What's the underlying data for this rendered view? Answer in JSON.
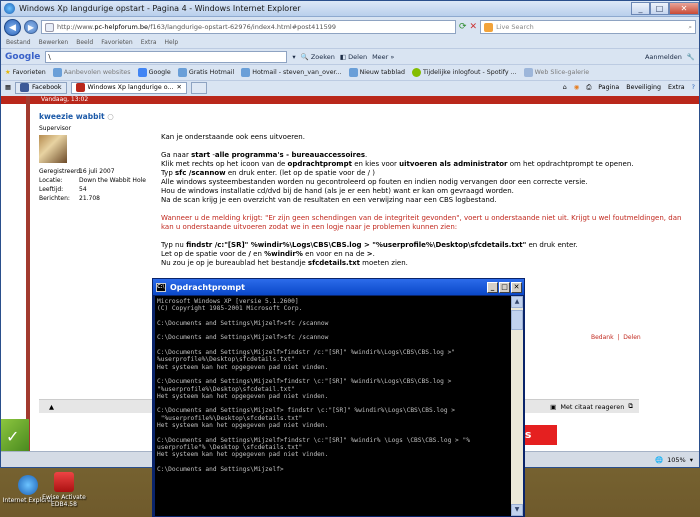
{
  "window": {
    "title": "Windows Xp langdurige opstart - Pagina 4 - Windows Internet Explorer",
    "controls": {
      "minimize": "_",
      "maximize": "□",
      "close": "✕"
    }
  },
  "address": {
    "url_prefix": "http://www.",
    "url_domain": "pc-helpforum.be",
    "url_path": "/f163/langdurige-opstart-62976/index4.html#post411599",
    "search_placeholder": "Live Search"
  },
  "menu": [
    "Bestand",
    "Bewerken",
    "Beeld",
    "Favorieten",
    "Extra",
    "Help"
  ],
  "google_toolbar": {
    "logo": "Google",
    "search_value": "\\",
    "search_button": "Zoeken",
    "share": "Delen",
    "more": "Meer »",
    "signin": "Aanmelden"
  },
  "favorites_bar": {
    "label": "Favorieten",
    "items": [
      {
        "label": "Aanbevolen websites",
        "dim": true
      },
      {
        "label": "Google",
        "dim": false
      },
      {
        "label": "Gratis Hotmail",
        "dim": false
      },
      {
        "label": "Hotmail - steven_van_over...",
        "dim": false
      },
      {
        "label": "Nieuw tabblad",
        "dim": false
      },
      {
        "label": "Tijdelijke inlogfout - Spotify ...",
        "dim": false
      },
      {
        "label": "Web Slice-galerie",
        "dim": true
      }
    ]
  },
  "tabs": [
    {
      "label": "Facebook"
    },
    {
      "label": "Windows Xp langdurige o..."
    }
  ],
  "command_bar": [
    "Pagina",
    "Beveiliging",
    "Extra"
  ],
  "page": {
    "top_strip": "Vandaag, 13:02",
    "user": {
      "name": "kweezie wabbit",
      "role": "Supervisor",
      "stats": [
        {
          "label": "Geregistreerd:",
          "value": "16 juli 2007"
        },
        {
          "label": "Locatie:",
          "value": "Down the Wabbit Hole"
        },
        {
          "label": "Leeftijd:",
          "value": "54"
        },
        {
          "label": "Berichten:",
          "value": "21.708"
        }
      ]
    },
    "post": {
      "p1": "Kan je onderstaande ook eens uitvoeren.",
      "p2a": "Ga naar ",
      "p2b": "start",
      "p2c": " -",
      "p2d": "alle programma's - bureauaccessoires",
      "p2e": ".",
      "p3a": "Klik met rechts op het icoon van de ",
      "p3b": "opdrachtprompt",
      "p3c": " en kies voor ",
      "p3d": "uitvoeren als administrator",
      "p3e": " om het opdrachtprompt te openen.",
      "p4a": "Typ ",
      "p4b": "sfc /scannow",
      "p4c": " en druk enter. (let op de spatie voor de / )",
      "p5": "Alle windows systeembestanden worden nu gecontroleerd op fouten en indien nodig vervangen door een correcte versie.",
      "p6": "Hou de windows installatie cd/dvd bij de hand (als je er een hebt) want er kan om gevraagd worden.",
      "p7": "Na de scan krijg je een overzicht van de resultaten en een verwijzing naar een CBS logbestand.",
      "warning": "Wanneer u de melding krijgt: \"Er zijn geen schendingen van de integriteit gevonden\", voert u onderstaande niet uit. Krijgt u wel foutmeldingen, dan kan u onderstaande uitvoeren zodat we in een logje naar je problemen kunnen zien:",
      "p8a": "Typ nu ",
      "p8b": "findstr /c:\"[SR]\" %windir%\\Logs\\CBS\\CBS.log > \"%userprofile%\\Desktop\\sfcdetails.txt\"",
      "p8c": " en druk enter.",
      "p9a": "Let op de spatie voor de ",
      "p9b": "/",
      "p9c": " en ",
      "p9d": "%windir%",
      "p9e": " en voor en na de ",
      "p9f": ">",
      "p9g": ".",
      "p10a": "Nu zou je op je bureaublad het bestandje ",
      "p10b": "sfcdetails.txt",
      "p10c": " moeten zien."
    },
    "post_actions": {
      "edit": "Bedank",
      "delete": "Delen"
    },
    "quote_button": "Met citaat reageren"
  },
  "status": {
    "zoom": "105%"
  },
  "cmd": {
    "title": "Opdrachtprompt",
    "output": "Microsoft Windows XP [versie 5.1.2600]\n(C) Copyright 1985-2001 Microsoft Corp.\n\nC:\\Documents and Settings\\Mijzelf>sfc /scannow\n\nC:\\Documents and Settings\\Mijzelf>sfc /scannow\n\nC:\\Documents and Settings\\Mijzelf>findstr /c:\"[SR]\" %windir%\\Logs\\CBS\\CBS.log >\"\n%userprofile%\\Desktop\\sfcdetails.txt\"\nHet systeem kan het opgegeven pad niet vinden.\n\nC:\\Documents and Settings\\Mijzelf>findstr \\c:\"[SR]\" %windir%\\Logs\\CBS\\CBS.log >\n\"%userprofile%\\Desktop\\sfcdetail.txt\"\nHet systeem kan het opgegeven pad niet vinden.\n\nC:\\Documents and Settings\\Mijzelf> findstr \\c:\"[SR]\" %windir%\\Logs\\CBS\\CBS.log >\n \"%userprofile%\\Desktop\\sfcdetails.txt\"\nHet systeem kan het opgegeven pad niet vinden.\n\nC:\\Documents and Settings\\Mijzelf>findstr \\c:\"[SR]\" %windir% \\Logs \\CBS\\CBS.log > \"%\nuserprofile\"% \\Desktop \\sfcdetails.txt\"\nHet systeem kan het opgegeven pad niet vinden.\n\nC:\\Documents and Settings\\Mijzelf>"
  },
  "desktop_icons": [
    {
      "label": "Internet Explorer"
    },
    {
      "label": "Ewise Activate EDB4.58"
    }
  ]
}
